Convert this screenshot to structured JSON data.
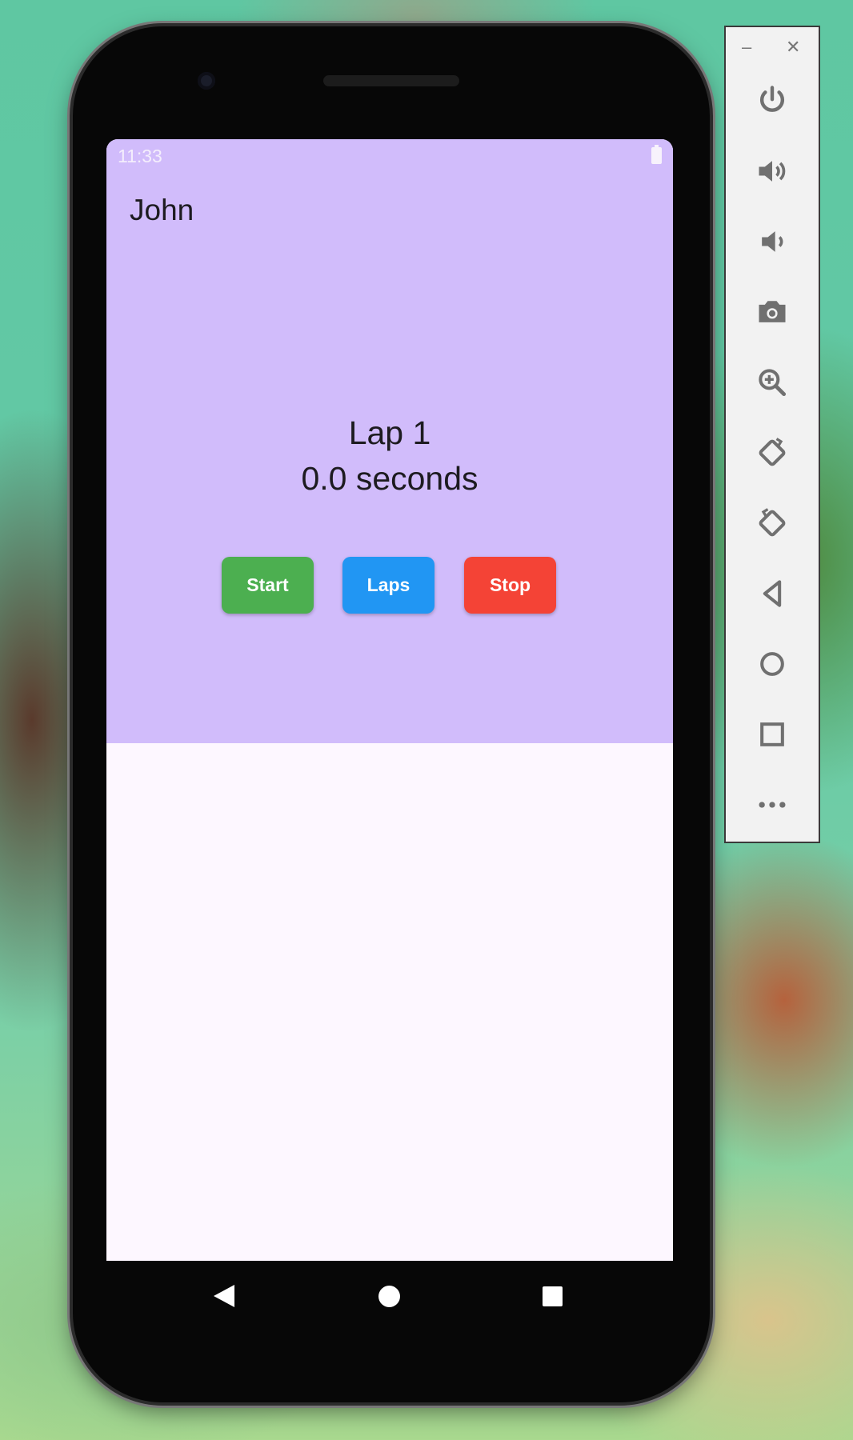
{
  "status_bar": {
    "time": "11:33",
    "battery_icon": "battery-full-icon"
  },
  "app": {
    "title": "John",
    "lap_label": "Lap 1",
    "lap_time": "0.0 seconds",
    "buttons": {
      "start": "Start",
      "laps": "Laps",
      "stop": "Stop"
    },
    "colors": {
      "header_bg": "#d1bcfb",
      "body_bg": "#fdf7ff",
      "start": "#4caf50",
      "laps": "#2196f3",
      "stop": "#f44336"
    }
  },
  "nav_bar": {
    "icons": [
      "back-icon",
      "home-icon",
      "recents-icon"
    ]
  },
  "emulator_panel": {
    "window_controls": {
      "minimize": "–",
      "close": "✕"
    },
    "icons": [
      "power-icon",
      "volume-up-icon",
      "volume-down-icon",
      "camera-icon",
      "zoom-icon",
      "rotate-left-icon",
      "rotate-right-icon",
      "back-icon",
      "home-icon",
      "overview-icon",
      "more-icon"
    ]
  }
}
